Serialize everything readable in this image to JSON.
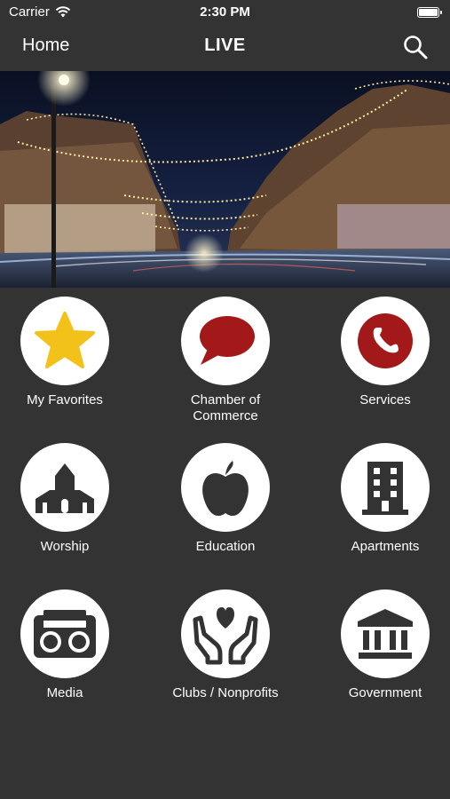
{
  "status_bar": {
    "carrier": "Carrier",
    "time": "2:30 PM"
  },
  "nav": {
    "home_label": "Home",
    "title": "LIVE",
    "search_icon": "search-icon"
  },
  "colors": {
    "background": "#333333",
    "star": "#f2c21a",
    "accent_red": "#a31919",
    "icon_dark": "#333333"
  },
  "tiles": [
    {
      "label": "My Favorites",
      "icon": "star-icon"
    },
    {
      "label": "Chamber of Commerce",
      "icon": "speech-bubble-icon"
    },
    {
      "label": "Services",
      "icon": "phone-icon"
    },
    {
      "label": "Worship",
      "icon": "church-icon"
    },
    {
      "label": "Education",
      "icon": "apple-icon"
    },
    {
      "label": "Apartments",
      "icon": "building-icon"
    },
    {
      "label": "Media",
      "icon": "radio-icon"
    },
    {
      "label": "Clubs / Nonprofits",
      "icon": "hands-heart-icon"
    },
    {
      "label": "Government",
      "icon": "bank-icon"
    }
  ]
}
